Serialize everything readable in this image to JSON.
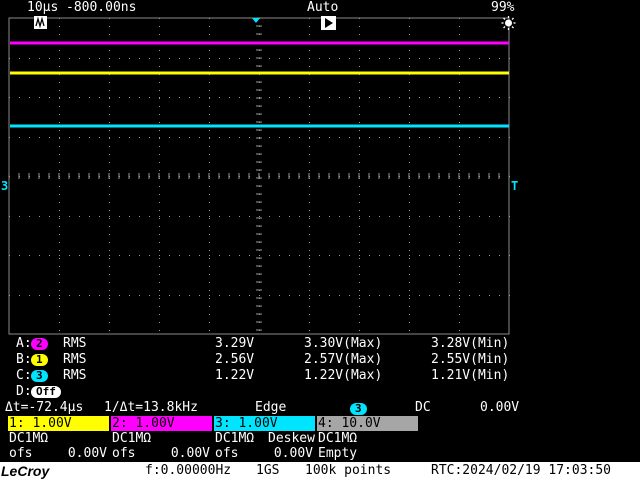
{
  "top": {
    "timebase": "10µs",
    "delay": "-800.00ns",
    "trigger_mode": "Auto",
    "battery": "99%"
  },
  "measurements": [
    {
      "label": "A:",
      "ch": "2",
      "func": "RMS",
      "value": "3.29V",
      "max": "3.30V(Max)",
      "min": "3.28V(Min)",
      "color": "#ff00ff"
    },
    {
      "label": "B:",
      "ch": "1",
      "func": "RMS",
      "value": "2.56V",
      "max": "2.57V(Max)",
      "min": "2.55V(Min)",
      "color": "#ffff00"
    },
    {
      "label": "C:",
      "ch": "3",
      "func": "RMS",
      "value": "1.22V",
      "max": "1.22V(Max)",
      "min": "1.21V(Min)",
      "color": "#00e5ff"
    },
    {
      "label": "D:",
      "ch": "Off",
      "func": "",
      "value": "",
      "max": "",
      "min": "",
      "color": "#ffffff"
    }
  ],
  "cursor": {
    "dt": "Δt=-72.4µs",
    "inv_dt": "1/Δt=13.8kHz"
  },
  "trigger": {
    "type": "Edge",
    "source": "3",
    "coupling": "DC",
    "level": "0.00V"
  },
  "channels": [
    {
      "head": "1: 1.00V",
      "coupling": "DC1MΩ",
      "extra": "",
      "ofs": "ofs",
      "ofs_value": "0.00V",
      "color": "#ffff00"
    },
    {
      "head": "2: 1.00V",
      "coupling": "DC1MΩ",
      "extra": "",
      "ofs": "ofs",
      "ofs_value": "0.00V",
      "color": "#ff00ff"
    },
    {
      "head": "3: 1.00V",
      "coupling": "DC1MΩ",
      "extra": "Deskew",
      "ofs": "ofs",
      "ofs_value": "0.00V",
      "color": "#00e5ff"
    },
    {
      "head": "4: 10.0V",
      "coupling": "DC1MΩ",
      "extra": "",
      "ofs": "Empty",
      "ofs_value": "",
      "color": "#a6a6a6"
    }
  ],
  "bottom": {
    "brand": "LeCroy",
    "freq": "f:0.00000Hz",
    "sample_rate": "1GS",
    "points": "100k points",
    "rtc": "RTC:2024/02/19 17:03:50"
  },
  "markers": {
    "left_ground": "3",
    "right_trigger": "T"
  },
  "traces": [
    {
      "name": "ch2-magenta",
      "color": "#ff00ff"
    },
    {
      "name": "ch1-yellow",
      "color": "#ffff00"
    },
    {
      "name": "ch3-cyan",
      "color": "#00e5ff"
    }
  ]
}
